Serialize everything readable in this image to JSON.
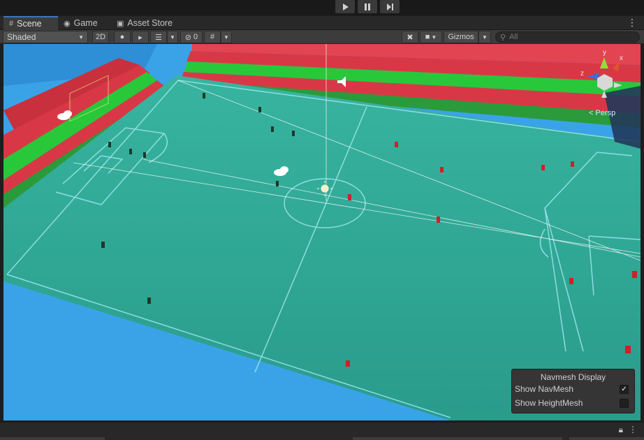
{
  "playbar": {
    "play_icon": "play-icon",
    "pause_icon": "pause-icon",
    "step_icon": "step-icon"
  },
  "tabs": [
    {
      "label": "Scene",
      "icon": "grid-icon",
      "active": true
    },
    {
      "label": "Game",
      "icon": "gamepad-icon",
      "active": false
    },
    {
      "label": "Asset Store",
      "icon": "bag-icon",
      "active": false
    }
  ],
  "toolbar": {
    "shading_mode": "Shaded",
    "toggle_2d": "2D",
    "hidden_count": "0",
    "gizmos_label": "Gizmos",
    "search_placeholder": "All"
  },
  "scene": {
    "projection_label": "< Persp",
    "axis_labels": {
      "x": "x",
      "y": "y",
      "z": "z"
    }
  },
  "navmesh_panel": {
    "title": "Navmesh Display",
    "show_navmesh_label": "Show NavMesh",
    "show_navmesh_checked": true,
    "show_heightmesh_label": "Show HeightMesh",
    "show_heightmesh_checked": false
  },
  "colors": {
    "field": "#2fa394",
    "sky": "#3aa3e8",
    "stand_red": "#d83846",
    "stand_green": "#28c83a",
    "accent_tab": "#3a79bb"
  }
}
